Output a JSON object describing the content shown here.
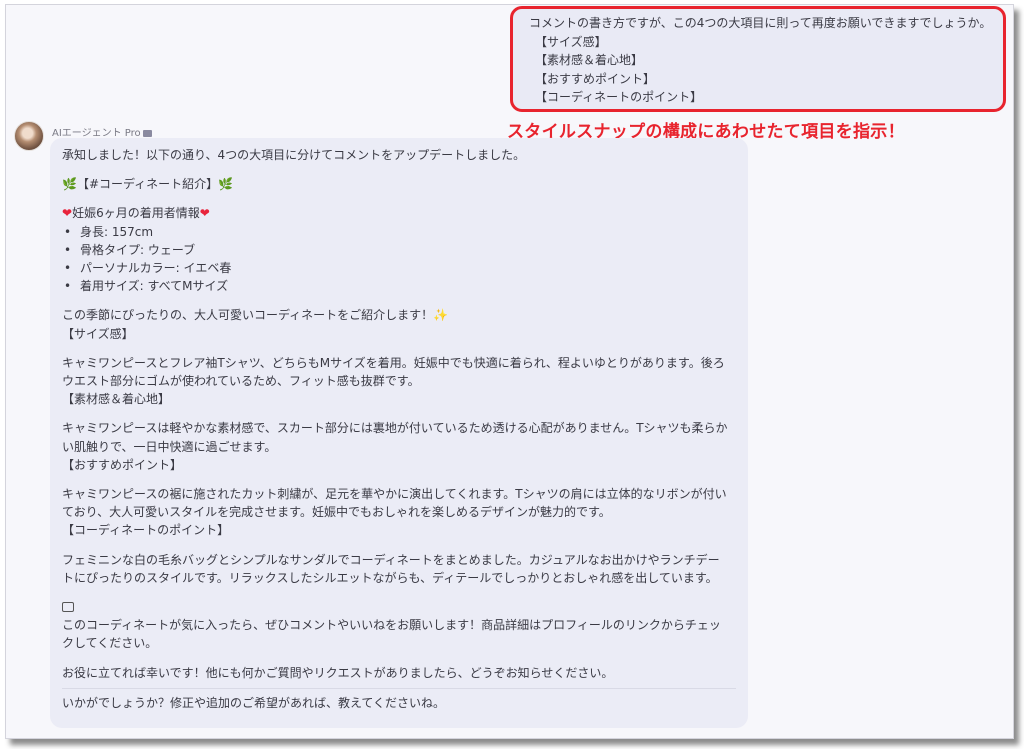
{
  "user_message": {
    "intro": "コメントの書き方ですが、この4つの大項目に則って再度お願いできますでしょうか。",
    "items": [
      "【サイズ感】",
      "【素材感＆着心地】",
      "【おすすめポイント】",
      "【コーディネートのポイント】"
    ]
  },
  "annotation": "スタイルスナップの構成にあわせたて項目を指示！",
  "agent": {
    "name": "AIエージェント Pro"
  },
  "reply": {
    "l1": "承知しました！以下の通り、4つの大項目に分けてコメントをアップデートしました。",
    "title_icon": "🌿",
    "title": "【#コーディネート紹介】",
    "info_icon": "❤",
    "info_title": "妊娠6ヶ月の着用者情報",
    "bullets": [
      "身長: 157cm",
      "骨格タイプ: ウェーブ",
      "パーソナルカラー: イエベ春",
      "着用サイズ: すべてMサイズ"
    ],
    "intro": "この季節にぴったりの、大人可愛いコーディネートをご紹介します！",
    "sparkle_icon": "✨",
    "s1_title": "【サイズ感】",
    "s1_l1": "キャミワンピースとフレア袖Tシャツ、どちらもMサイズを着用。妊娠中でも快適に着られ、程よいゆとりがあります。後ろ",
    "s1_l2": "ウエスト部分にゴムが使われているため、フィット感も抜群です。",
    "s2_title": "【素材感＆着心地】",
    "s2_l1": "キャミワンピースは軽やかな素材感で、スカート部分には裏地が付いているため透ける心配がありません。Tシャツも柔らか",
    "s2_l2": "い肌触りで、一日中快適に過ごせます。",
    "s3_title": "【おすすめポイント】",
    "s3_l1": "キャミワンピースの裾に施されたカット刺繍が、足元を華やかに演出してくれます。Tシャツの肩には立体的なリボンが付い",
    "s3_l2": "ており、大人可愛いスタイルを完成させます。妊娠中でもおしゃれを楽しめるデザインが魅力的です。",
    "s4_title": "【コーディネートのポイント】",
    "s4_l1": "フェミニンな白の毛糸バッグとシンプルなサンダルでコーディネートをまとめました。カジュアルなお出かけやランチデー",
    "s4_l2": "トにぴったりのスタイルです。リラックスしたシルエットながらも、ディテールでしっかりとおしゃれ感を出しています。",
    "cta_l1": "このコーディネートが気に入ったら、ぜひコメントやいいねをお願いします！商品詳細はプロフィールのリンクからチェッ",
    "cta_l2": "クしてください。",
    "closing": "お役に立てれば幸いです！他にも何かご質問やリクエストがありましたら、どうぞお知らせください。",
    "final": "いかがでしょうか？修正や追加のご希望があれば、教えてくださいね。"
  }
}
